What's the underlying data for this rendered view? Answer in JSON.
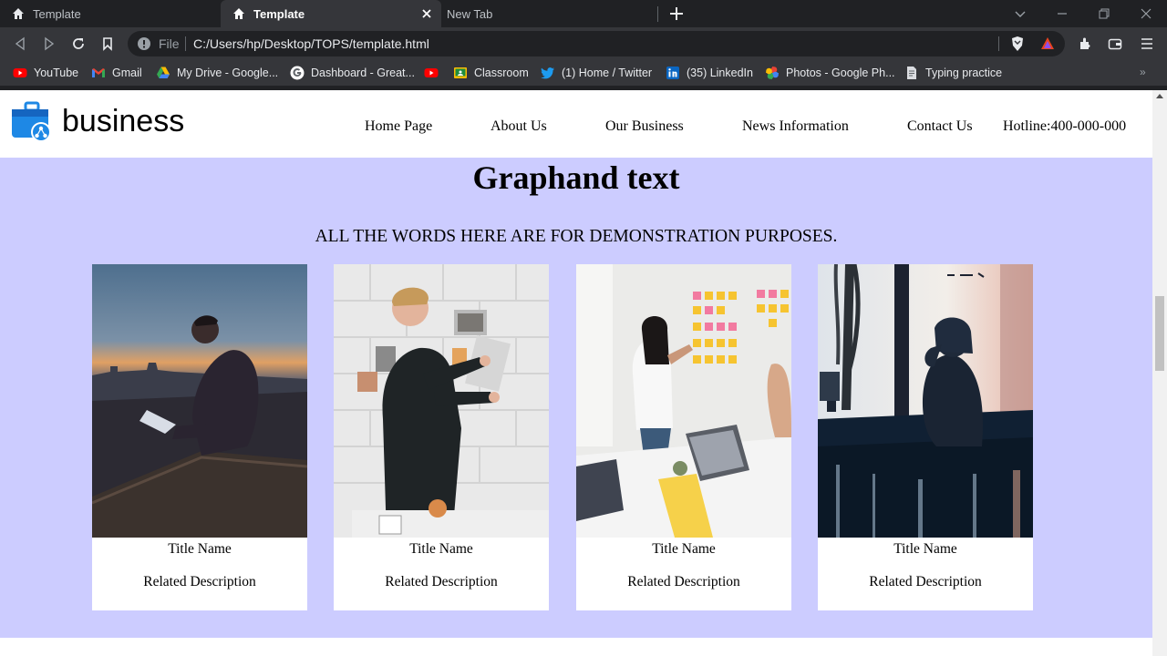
{
  "browser": {
    "tabs": [
      {
        "label": "Template",
        "active": false
      },
      {
        "label": "Template",
        "active": true
      },
      {
        "label": "New Tab",
        "active": false
      }
    ],
    "address": {
      "scheme_label": "File",
      "url": "C:/Users/hp/Desktop/TOPS/template.html"
    },
    "bookmarks": [
      {
        "label": "YouTube",
        "icon": "youtube-icon"
      },
      {
        "label": "Gmail",
        "icon": "gmail-icon"
      },
      {
        "label": "My Drive - Google...",
        "icon": "google-drive-icon"
      },
      {
        "label": "Dashboard - Great...",
        "icon": "google-icon"
      },
      {
        "label": "",
        "icon": "youtube-icon"
      },
      {
        "label": "Classroom",
        "icon": "classroom-icon"
      },
      {
        "label": "(1) Home / Twitter",
        "icon": "twitter-icon"
      },
      {
        "label": "(35) LinkedIn",
        "icon": "linkedin-icon"
      },
      {
        "label": "Photos - Google Ph...",
        "icon": "google-photos-icon"
      },
      {
        "label": "Typing practice",
        "icon": "page-icon"
      }
    ]
  },
  "site": {
    "logo_text": "business",
    "nav": [
      "Home Page",
      "About Us",
      "Our Business",
      "News Information",
      "Contact Us"
    ],
    "hotline": "Hotline:400-000-000",
    "heading": "Graphand text",
    "subheading": "ALL THE WORDS HERE ARE FOR DEMONSTRATION PURPOSES.",
    "cards": [
      {
        "title": "Title Name",
        "description": "Related Description"
      },
      {
        "title": "Title Name",
        "description": "Related Description"
      },
      {
        "title": "Title Name",
        "description": "Related Description"
      },
      {
        "title": "Title Name",
        "description": "Related Description"
      }
    ]
  },
  "colors": {
    "browser_dark": "#202124",
    "browser_toolbar": "#35363a",
    "page_background": "#ccccff",
    "card_background": "#ffffff",
    "logo_blue": "#1e88e5"
  }
}
